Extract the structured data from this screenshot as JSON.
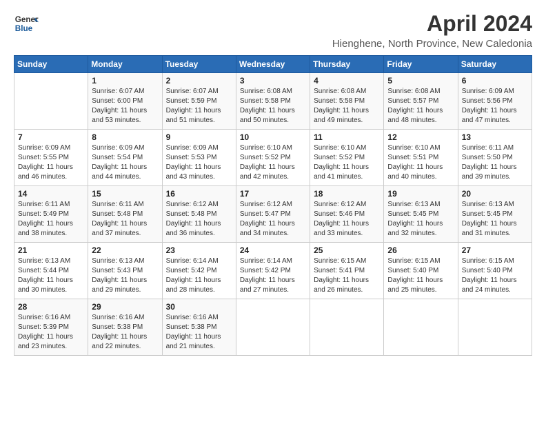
{
  "logo": {
    "line1": "General",
    "line2": "Blue"
  },
  "title": "April 2024",
  "location": "Hienghene, North Province, New Caledonia",
  "days_of_week": [
    "Sunday",
    "Monday",
    "Tuesday",
    "Wednesday",
    "Thursday",
    "Friday",
    "Saturday"
  ],
  "weeks": [
    [
      {
        "day": "",
        "info": ""
      },
      {
        "day": "1",
        "info": "Sunrise: 6:07 AM\nSunset: 6:00 PM\nDaylight: 11 hours\nand 53 minutes."
      },
      {
        "day": "2",
        "info": "Sunrise: 6:07 AM\nSunset: 5:59 PM\nDaylight: 11 hours\nand 51 minutes."
      },
      {
        "day": "3",
        "info": "Sunrise: 6:08 AM\nSunset: 5:58 PM\nDaylight: 11 hours\nand 50 minutes."
      },
      {
        "day": "4",
        "info": "Sunrise: 6:08 AM\nSunset: 5:58 PM\nDaylight: 11 hours\nand 49 minutes."
      },
      {
        "day": "5",
        "info": "Sunrise: 6:08 AM\nSunset: 5:57 PM\nDaylight: 11 hours\nand 48 minutes."
      },
      {
        "day": "6",
        "info": "Sunrise: 6:09 AM\nSunset: 5:56 PM\nDaylight: 11 hours\nand 47 minutes."
      }
    ],
    [
      {
        "day": "7",
        "info": "Sunrise: 6:09 AM\nSunset: 5:55 PM\nDaylight: 11 hours\nand 46 minutes."
      },
      {
        "day": "8",
        "info": "Sunrise: 6:09 AM\nSunset: 5:54 PM\nDaylight: 11 hours\nand 44 minutes."
      },
      {
        "day": "9",
        "info": "Sunrise: 6:09 AM\nSunset: 5:53 PM\nDaylight: 11 hours\nand 43 minutes."
      },
      {
        "day": "10",
        "info": "Sunrise: 6:10 AM\nSunset: 5:52 PM\nDaylight: 11 hours\nand 42 minutes."
      },
      {
        "day": "11",
        "info": "Sunrise: 6:10 AM\nSunset: 5:52 PM\nDaylight: 11 hours\nand 41 minutes."
      },
      {
        "day": "12",
        "info": "Sunrise: 6:10 AM\nSunset: 5:51 PM\nDaylight: 11 hours\nand 40 minutes."
      },
      {
        "day": "13",
        "info": "Sunrise: 6:11 AM\nSunset: 5:50 PM\nDaylight: 11 hours\nand 39 minutes."
      }
    ],
    [
      {
        "day": "14",
        "info": "Sunrise: 6:11 AM\nSunset: 5:49 PM\nDaylight: 11 hours\nand 38 minutes."
      },
      {
        "day": "15",
        "info": "Sunrise: 6:11 AM\nSunset: 5:48 PM\nDaylight: 11 hours\nand 37 minutes."
      },
      {
        "day": "16",
        "info": "Sunrise: 6:12 AM\nSunset: 5:48 PM\nDaylight: 11 hours\nand 36 minutes."
      },
      {
        "day": "17",
        "info": "Sunrise: 6:12 AM\nSunset: 5:47 PM\nDaylight: 11 hours\nand 34 minutes."
      },
      {
        "day": "18",
        "info": "Sunrise: 6:12 AM\nSunset: 5:46 PM\nDaylight: 11 hours\nand 33 minutes."
      },
      {
        "day": "19",
        "info": "Sunrise: 6:13 AM\nSunset: 5:45 PM\nDaylight: 11 hours\nand 32 minutes."
      },
      {
        "day": "20",
        "info": "Sunrise: 6:13 AM\nSunset: 5:45 PM\nDaylight: 11 hours\nand 31 minutes."
      }
    ],
    [
      {
        "day": "21",
        "info": "Sunrise: 6:13 AM\nSunset: 5:44 PM\nDaylight: 11 hours\nand 30 minutes."
      },
      {
        "day": "22",
        "info": "Sunrise: 6:13 AM\nSunset: 5:43 PM\nDaylight: 11 hours\nand 29 minutes."
      },
      {
        "day": "23",
        "info": "Sunrise: 6:14 AM\nSunset: 5:42 PM\nDaylight: 11 hours\nand 28 minutes."
      },
      {
        "day": "24",
        "info": "Sunrise: 6:14 AM\nSunset: 5:42 PM\nDaylight: 11 hours\nand 27 minutes."
      },
      {
        "day": "25",
        "info": "Sunrise: 6:15 AM\nSunset: 5:41 PM\nDaylight: 11 hours\nand 26 minutes."
      },
      {
        "day": "26",
        "info": "Sunrise: 6:15 AM\nSunset: 5:40 PM\nDaylight: 11 hours\nand 25 minutes."
      },
      {
        "day": "27",
        "info": "Sunrise: 6:15 AM\nSunset: 5:40 PM\nDaylight: 11 hours\nand 24 minutes."
      }
    ],
    [
      {
        "day": "28",
        "info": "Sunrise: 6:16 AM\nSunset: 5:39 PM\nDaylight: 11 hours\nand 23 minutes."
      },
      {
        "day": "29",
        "info": "Sunrise: 6:16 AM\nSunset: 5:38 PM\nDaylight: 11 hours\nand 22 minutes."
      },
      {
        "day": "30",
        "info": "Sunrise: 6:16 AM\nSunset: 5:38 PM\nDaylight: 11 hours\nand 21 minutes."
      },
      {
        "day": "",
        "info": ""
      },
      {
        "day": "",
        "info": ""
      },
      {
        "day": "",
        "info": ""
      },
      {
        "day": "",
        "info": ""
      }
    ]
  ]
}
